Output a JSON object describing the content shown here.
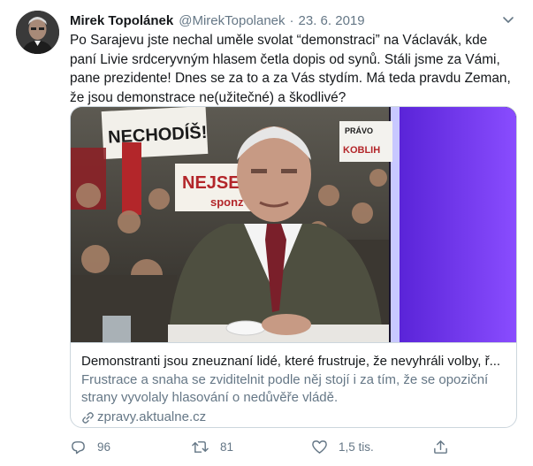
{
  "tweet": {
    "author_name": "Mirek Topolánek",
    "author_handle": "@MirekTopolanek",
    "separator": "·",
    "date": "23. 6. 2019",
    "text": "Po Sarajevu jste nechal uměle svolat “demonstraci” na Václavák, kde paní Livie srdceryvným hlasem četla dopis od synů. Stáli jsme za Vámi, pane prezidente! Dnes se za  to a za Vás stydím. Má teda pravdu Zeman, že jsou demonstrace ne(užitečné) a škodlivé?"
  },
  "card": {
    "image_signs": {
      "sign1": "NECHODÍŠ!",
      "sign2": "NEJSEM",
      "sign2b": "sponz",
      "sign3": "PRÁVO",
      "sign3b": "KOBLIH"
    },
    "title": "Demonstranti jsou zneuznaní lidé, které frustruje, že nevyhráli volby, ř...",
    "description": "Frustrace a snaha se zviditelnit podle něj stojí i za tím, že se opoziční strany vyvolaly hlasování o nedůvěře vládě.",
    "domain": "zpravy.aktualne.cz"
  },
  "actions": {
    "reply_count": "96",
    "retweet_count": "81",
    "like_count": "1,5 tis."
  },
  "icons": {
    "caret": "chevron-down-icon",
    "link": "link-icon",
    "reply": "reply-icon",
    "retweet": "retweet-icon",
    "like": "heart-icon",
    "share": "share-icon"
  },
  "colors": {
    "text_primary": "#14171a",
    "text_secondary": "#657786",
    "border": "#ccd6dd",
    "studio_purple": "#7a3cff"
  }
}
